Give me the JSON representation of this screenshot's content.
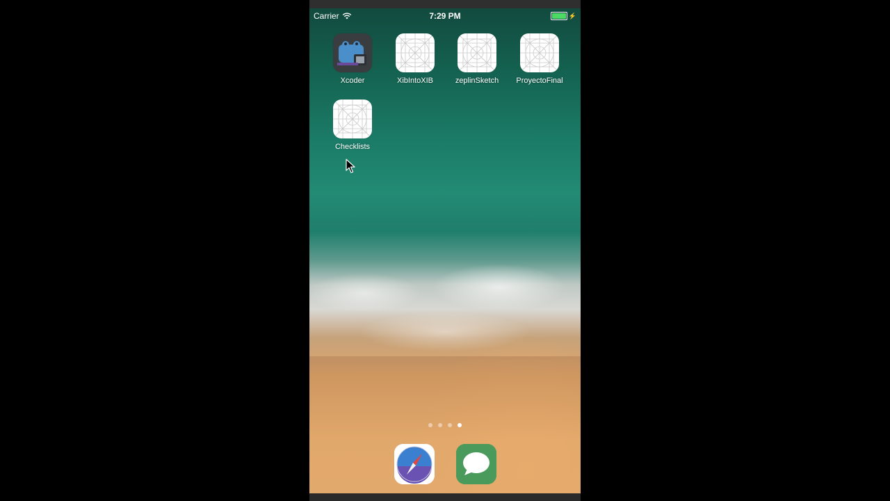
{
  "status_bar": {
    "carrier": "Carrier",
    "time": "7:29 PM",
    "battery_color": "#4cd964"
  },
  "apps": [
    {
      "label": "Xcoder",
      "icon": "xcoder-app-icon"
    },
    {
      "label": "XibIntoXIB",
      "icon": "placeholder-app-icon"
    },
    {
      "label": "zeplinSketch",
      "icon": "placeholder-app-icon"
    },
    {
      "label": "ProyectoFinal",
      "icon": "placeholder-app-icon"
    },
    {
      "label": "Checklists",
      "icon": "placeholder-app-icon"
    }
  ],
  "page_indicator": {
    "count": 4,
    "active_index": 3
  },
  "dock": [
    {
      "name": "Safari",
      "icon": "safari-icon"
    },
    {
      "name": "Messages",
      "icon": "messages-icon"
    }
  ]
}
